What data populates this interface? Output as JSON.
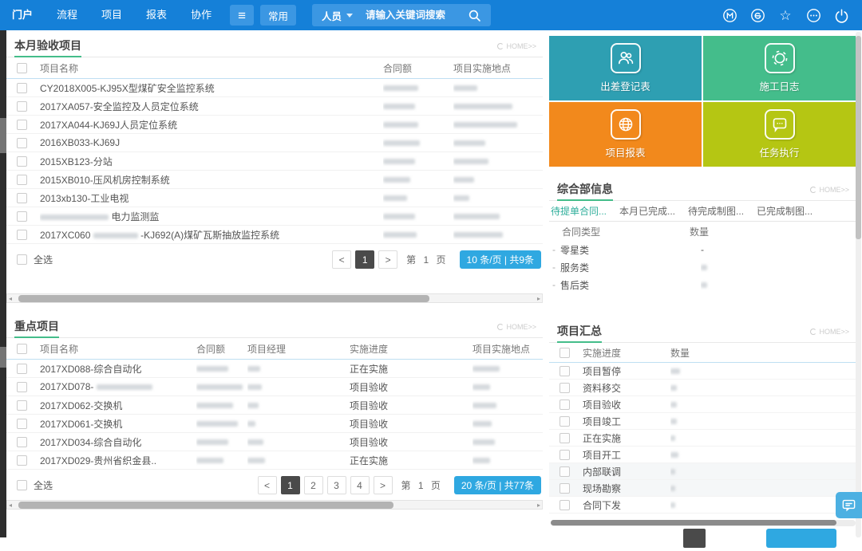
{
  "colors": {
    "navbar_blue": "#1580d8",
    "navbar_button_blue": "#3b97e3",
    "section_underline_green": "#44bd8a",
    "pager_badge_blue": "#2fa8e1",
    "active_page_dark": "#4a4a4a",
    "active_tab_teal": "#2fae9b"
  },
  "navbar": {
    "menu": [
      "门户",
      "流程",
      "项目",
      "报表",
      "协作"
    ],
    "hamburger_icon": "hamburger-icon",
    "quick_label": "常用",
    "person_label": "人员",
    "search_placeholder": "请输入关键词搜索",
    "right_icons": [
      "m-circle-icon",
      "message-circle-icon",
      "star-icon",
      "ellipsis-circle-icon",
      "power-icon"
    ]
  },
  "common": {
    "more_label": "HOME>>"
  },
  "sections": {
    "acceptance": {
      "title": "本月验收项目",
      "columns": {
        "name": "项目名称",
        "amount": "合同额",
        "location": "项目实施地点"
      },
      "rows": [
        {
          "name": "CY2018X005-KJ95X型煤矿安全监控系统"
        },
        {
          "name": "2017XA057-安全监控及人员定位系统"
        },
        {
          "name": "2017XA044-KJ69J人员定位系统"
        },
        {
          "name": "2016XB033-KJ69J"
        },
        {
          "name": "2015XB123-分站"
        },
        {
          "name": "2015XB010-压风机房控制系统"
        },
        {
          "name": "2013xb130-工业电视"
        },
        {
          "name": "电力监测监",
          "blur_before": true
        },
        {
          "name": "2017XC060",
          "blur_mid": true,
          "name2": "-KJ692(A)煤矿瓦斯抽放监控系统"
        }
      ],
      "select_all": "全选",
      "pager": {
        "prev": "<",
        "page": "1",
        "next": ">",
        "jump": "第 1 页",
        "badge": "10 条/页 | 共9条"
      }
    },
    "key_projects": {
      "title": "重点项目",
      "columns": {
        "name": "项目名称",
        "amount": "合同额",
        "manager": "项目经理",
        "progress": "实施进度",
        "location": "项目实施地点"
      },
      "rows": [
        {
          "name": "2017XD088-综合自动化",
          "progress": "正在实施"
        },
        {
          "name": "2017XD078-",
          "blur_after": true,
          "progress": "项目验收"
        },
        {
          "name": "2017XD062-交换机",
          "progress": "项目验收"
        },
        {
          "name": "2017XD061-交换机",
          "progress": "项目验收"
        },
        {
          "name": "2017XD034-综合自动化",
          "progress": "项目验收"
        },
        {
          "name": "2017XD029-贵州省织金县..",
          "progress": "正在实施"
        }
      ],
      "select_all": "全选",
      "pager": {
        "prev": "<",
        "pages": [
          "1",
          "2",
          "3",
          "4"
        ],
        "active": "1",
        "next": ">",
        "jump": "第 1 页",
        "badge": "20 条/页 | 共77条"
      }
    },
    "tiles": [
      {
        "label": "出差登记表",
        "color": "#2e9fb2",
        "icon": "users-icon"
      },
      {
        "label": "施工日志",
        "color": "#44bd8b",
        "icon": "aperture-icon"
      },
      {
        "label": "项目报表",
        "color": "#f2891c",
        "icon": "globe-icon"
      },
      {
        "label": "任务执行",
        "color": "#b5c613",
        "icon": "chat-icon"
      }
    ],
    "dept_info": {
      "title": "综合部信息",
      "tabs": [
        "待提单合同...",
        "本月已完成...",
        "待完成制图...",
        "已完成制图..."
      ],
      "active_tab": "待提单合同...",
      "columns": {
        "type": "合同类型",
        "qty": "数量"
      },
      "rows": [
        {
          "type": "零星类",
          "qty": "-"
        },
        {
          "type": "服务类",
          "qty": ""
        },
        {
          "type": "售后类",
          "qty": ""
        }
      ]
    },
    "summary": {
      "title": "项目汇总",
      "columns": {
        "progress": "实施进度",
        "qty": "数量"
      },
      "rows": [
        {
          "label": "项目暂停"
        },
        {
          "label": "资料移交"
        },
        {
          "label": "项目验收"
        },
        {
          "label": "项目竣工"
        },
        {
          "label": "正在实施"
        },
        {
          "label": "项目开工"
        },
        {
          "label": "内部联调"
        },
        {
          "label": "现场勘察"
        },
        {
          "label": "合同下发"
        }
      ]
    }
  }
}
